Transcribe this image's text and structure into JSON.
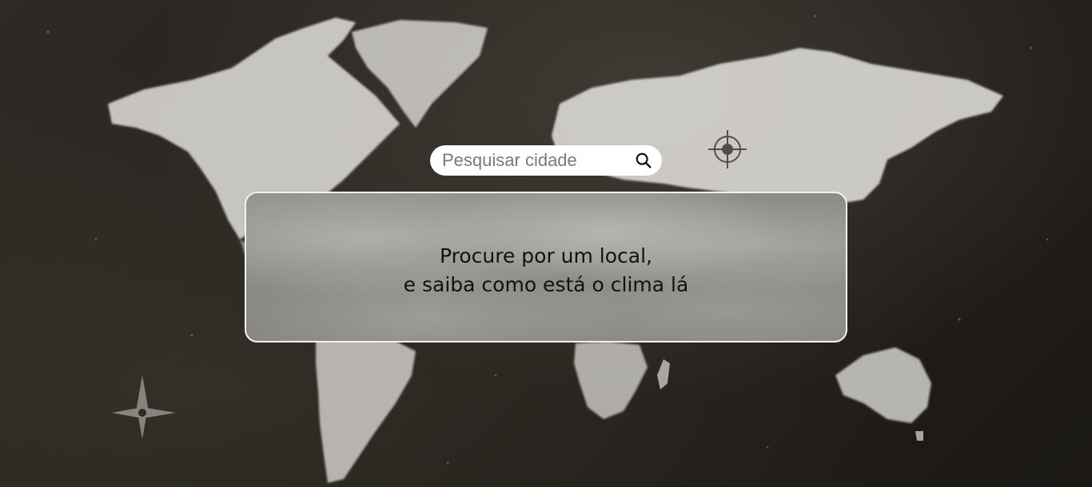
{
  "search": {
    "placeholder": "Pesquisar cidade",
    "value": "",
    "icon": "search-icon"
  },
  "message": {
    "line1": "Procure por um local,",
    "line2": "e saiba como está o clima lá"
  },
  "colors": {
    "background": "#231f1b",
    "card_background": "#8a8985",
    "card_border": "#f2f2f2",
    "search_background": "#ffffff"
  }
}
